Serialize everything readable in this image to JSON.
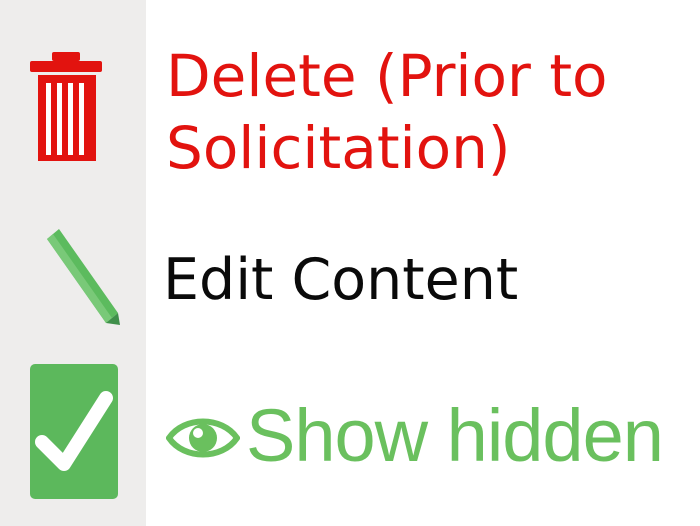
{
  "colors": {
    "strip_bg": "#eeedec",
    "delete": "#e2130f",
    "edit_text": "#0a0a0a",
    "pencil": "#5cbb5e",
    "checkbox": "#5cb85c",
    "show_hidden": "#6ac05e"
  },
  "delete_action": {
    "icon": "trash-icon",
    "label_line1": "Delete (Prior to",
    "label_line2": "Solicitation)"
  },
  "edit_action": {
    "icon": "pencil-icon",
    "label": "Edit Content"
  },
  "show_hidden_action": {
    "checkbox_icon": "checkbox-checked-icon",
    "eye_icon": "eye-icon",
    "label": "Show hidden",
    "checked": true
  }
}
